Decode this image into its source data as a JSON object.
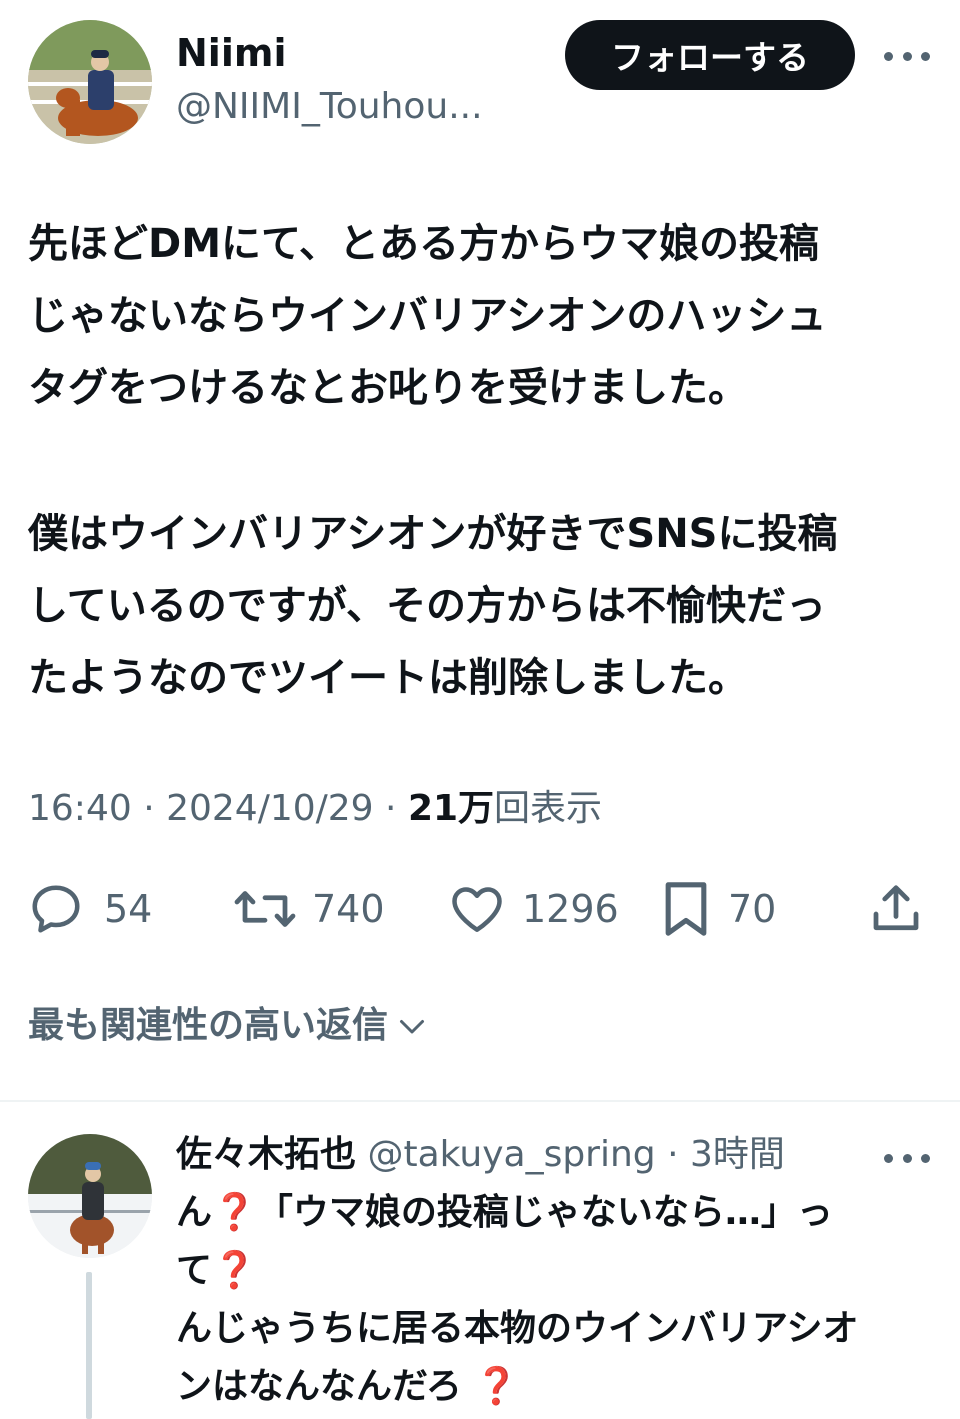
{
  "author": {
    "display_name": "Niimi",
    "handle": "@NIIMI_Touhou..."
  },
  "header": {
    "follow_label": "フォローする"
  },
  "tweet": {
    "paragraphs": [
      [
        "先ほどDMにて、とある方からウマ娘の投稿",
        "じゃないならウインバリアシオンのハッシュ",
        "タグをつけるなとお叱りを受けました。"
      ],
      [
        "僕はウインバリアシオンが好きでSNSに投稿",
        "しているのですが、その方からは不愉快だっ",
        "たようなのでツイートは削除しました。"
      ]
    ],
    "time": "16:40",
    "date": "2024/10/29",
    "views_number": "21万",
    "views_label": "回表示",
    "separator": " · "
  },
  "actions": {
    "replies": "54",
    "retweets": "740",
    "likes": "1296",
    "bookmarks": "70"
  },
  "replies_sort": {
    "label": "最も関連性の高い返信"
  },
  "reply": {
    "display_name": "佐々木拓也",
    "handle": "@takuya_spring",
    "time_ago": "3時間",
    "line1_a": "ん",
    "line1_b": "「ウマ娘の投稿じゃないなら…」っ",
    "line2": "て",
    "line3": "んじゃうちに居る本物のウインバリアシオ",
    "line4": "ンはなんなんだろ",
    "emoji": "❓"
  },
  "colors": {
    "text": "#0f1419",
    "secondary": "#536471",
    "follow_bg": "#0f1419",
    "emoji_red": "#d61b1b"
  }
}
